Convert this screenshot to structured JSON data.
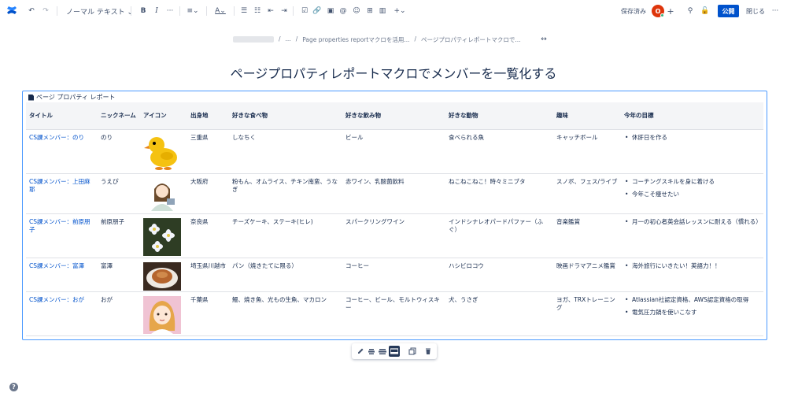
{
  "toolbar": {
    "text_style": "ノーマル テキスト ⌄",
    "saved": "保存済み",
    "avatar_initial": "O",
    "publish": "公開",
    "close": "閉じる",
    "undo_icon": "undo-icon",
    "redo_icon": "redo-icon",
    "colors": {
      "brand": "#0052cc",
      "avatar": "#de350b"
    }
  },
  "breadcrumb": {
    "items": [
      "...",
      "Page properties reportマクロを活用...",
      "ページプロパティレポートマクロで..."
    ]
  },
  "page": {
    "title": "ページプロパティレポートマクロでメンバーを一覧化する"
  },
  "macro": {
    "label": "ページ プロパティ レポート"
  },
  "table": {
    "headers": [
      "タイトル",
      "ニックネーム",
      "アイコン",
      "出身地",
      "好きな食べ物",
      "好きな飲み物",
      "好きな動物",
      "趣味",
      "今年の目標"
    ],
    "rows": [
      {
        "title": "CS課メンバー：のり",
        "nickname": "のり",
        "icon": "duck",
        "origin": "三重県",
        "food": "しなちく",
        "drink": "ビール",
        "animal": "食べられる魚",
        "hobby": "キャッチボール",
        "goals": [
          "休肝日を作る"
        ]
      },
      {
        "title": "CS課メンバー：上田麻耶",
        "nickname": "うえぴ",
        "icon": "woman-illustration",
        "origin": "大阪府",
        "food": "粉もん、オムライス、チキン南蛮、うなぎ",
        "drink": "赤ワイン、乳酸菌飲料",
        "animal": "ねこねこねこ！時々ミニブタ",
        "hobby": "スノボ、フェス/ライブ",
        "goals": [
          "コーチングスキルを身に着ける",
          "今年こそ痩せたい"
        ]
      },
      {
        "title": "CS課メンバー：前原朋子",
        "nickname": "前原朋子",
        "icon": "flowers",
        "origin": "奈良県",
        "food": "チーズケーキ、ステーキ(ヒレ)",
        "drink": "スパークリングワイン",
        "animal": "インドシナレオパードパファー（ふぐ）",
        "hobby": "音楽鑑賞",
        "goals": [
          "月一の初心者英会話レッスンに耐える（慣れる）"
        ]
      },
      {
        "title": "CS課メンバー：富澤",
        "nickname": "富澤",
        "icon": "bread",
        "origin": "埼玉県川越市",
        "food": "パン（焼きたてに限る）",
        "drink": "コーヒー",
        "animal": "ハシビロコウ",
        "hobby": "映画ドラマアニメ鑑賞",
        "goals": [
          "海外旅行にいきたい！英語力！！"
        ]
      },
      {
        "title": "CS課メンバー：おが",
        "nickname": "おが",
        "icon": "girl-illustration",
        "origin": "千葉県",
        "food": "鰻、焼き魚、光もの生魚、マカロン",
        "drink": "コーヒー、ビール、モルトウィスキー",
        "animal": "犬、うさぎ",
        "hobby": "ヨガ、TRXトレーニング",
        "goals": [
          "Atlassian社認定資格、AWS認定資格の取得",
          "電気圧力鍋を使いこなす"
        ]
      }
    ]
  },
  "bottom_toolbar": {
    "icons": [
      "edit-icon",
      "align-center-icon",
      "align-wide-icon",
      "full-width-icon",
      "copy-icon",
      "delete-icon"
    ]
  },
  "help": {
    "icon": "?"
  }
}
